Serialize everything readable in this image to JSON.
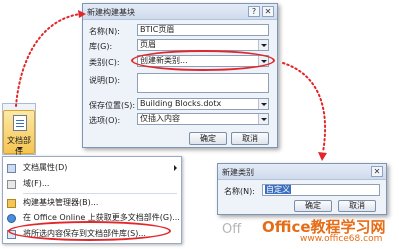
{
  "new_block_dialog": {
    "title": "新建构建基块",
    "help_btn": "?",
    "close_btn": "✕",
    "fields": {
      "name_label": "名称(N):",
      "name_value": "BTIC页眉",
      "gallery_label": "库(G):",
      "gallery_value": "页眉",
      "category_label": "类别(C):",
      "category_value": "创建新类别...",
      "description_label": "说明(D):",
      "save_in_label": "保存位置(S):",
      "save_in_value": "Building Blocks.dotx",
      "options_label": "选项(O):",
      "options_value": "仅插入内容"
    },
    "ok": "确定",
    "cancel": "取消"
  },
  "office_menu": {
    "ribbon_label": "文档部件",
    "items": [
      {
        "label": "文档属性(D)",
        "icon": "document-properties-icon",
        "submenu": true
      },
      {
        "label": "域(F)...",
        "icon": "field-icon",
        "submenu": false
      },
      {
        "label": "构建基块管理器(B)...",
        "icon": "building-blocks-icon",
        "submenu": false
      },
      {
        "label": "在 Office Online 上获取更多文档部件(G)...",
        "icon": "office-online-icon",
        "submenu": false
      },
      {
        "label": "将所选内容保存到文档部件库(S)...",
        "icon": "save-selection-icon",
        "submenu": false
      }
    ]
  },
  "new_category_dialog": {
    "title": "新建类别",
    "close_btn": "✕",
    "name_label": "名称(N):",
    "name_value": "自定义",
    "ok": "确定",
    "cancel": "取消"
  },
  "watermark": {
    "site_name": "Office教程学习网",
    "site_url": "www.office68.com",
    "faint": "Off"
  },
  "colors": {
    "highlight": "#e2262a",
    "logo": "#e66c16",
    "dialog_bg": "#eef3fa"
  }
}
